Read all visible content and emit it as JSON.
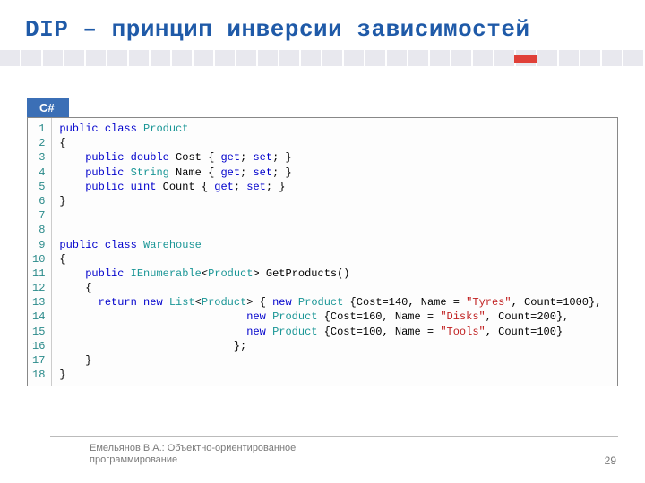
{
  "slide": {
    "title": "DIP – принцип инверсии зависимостей",
    "language_tab": "C#",
    "footer_author": "Емельянов В.А.: Объектно-ориентированное программирование",
    "page_number": "29"
  },
  "code": {
    "line_numbers": [
      "1",
      "2",
      "3",
      "4",
      "5",
      "6",
      "7",
      "8",
      "9",
      "10",
      "11",
      "12",
      "13",
      "14",
      "15",
      "16",
      "17",
      "18"
    ],
    "lines": [
      [
        {
          "t": "public",
          "c": "kw"
        },
        {
          "t": " ",
          "c": "plain"
        },
        {
          "t": "class",
          "c": "kw"
        },
        {
          "t": " ",
          "c": "plain"
        },
        {
          "t": "Product",
          "c": "type"
        }
      ],
      [
        {
          "t": "{",
          "c": "plain"
        }
      ],
      [
        {
          "t": "    ",
          "c": "plain"
        },
        {
          "t": "public",
          "c": "kw"
        },
        {
          "t": " ",
          "c": "plain"
        },
        {
          "t": "double",
          "c": "kw"
        },
        {
          "t": " Cost { ",
          "c": "plain"
        },
        {
          "t": "get",
          "c": "kw"
        },
        {
          "t": "; ",
          "c": "plain"
        },
        {
          "t": "set",
          "c": "kw"
        },
        {
          "t": "; }",
          "c": "plain"
        }
      ],
      [
        {
          "t": "    ",
          "c": "plain"
        },
        {
          "t": "public",
          "c": "kw"
        },
        {
          "t": " ",
          "c": "plain"
        },
        {
          "t": "String",
          "c": "type"
        },
        {
          "t": " Name { ",
          "c": "plain"
        },
        {
          "t": "get",
          "c": "kw"
        },
        {
          "t": "; ",
          "c": "plain"
        },
        {
          "t": "set",
          "c": "kw"
        },
        {
          "t": "; }",
          "c": "plain"
        }
      ],
      [
        {
          "t": "    ",
          "c": "plain"
        },
        {
          "t": "public",
          "c": "kw"
        },
        {
          "t": " ",
          "c": "plain"
        },
        {
          "t": "uint",
          "c": "kw"
        },
        {
          "t": " Count { ",
          "c": "plain"
        },
        {
          "t": "get",
          "c": "kw"
        },
        {
          "t": "; ",
          "c": "plain"
        },
        {
          "t": "set",
          "c": "kw"
        },
        {
          "t": "; }",
          "c": "plain"
        }
      ],
      [
        {
          "t": "}",
          "c": "plain"
        }
      ],
      [
        {
          "t": " ",
          "c": "plain"
        }
      ],
      [
        {
          "t": " ",
          "c": "plain"
        }
      ],
      [
        {
          "t": "public",
          "c": "kw"
        },
        {
          "t": " ",
          "c": "plain"
        },
        {
          "t": "class",
          "c": "kw"
        },
        {
          "t": " ",
          "c": "plain"
        },
        {
          "t": "Warehouse",
          "c": "type"
        }
      ],
      [
        {
          "t": "{",
          "c": "plain"
        }
      ],
      [
        {
          "t": "    ",
          "c": "plain"
        },
        {
          "t": "public",
          "c": "kw"
        },
        {
          "t": " ",
          "c": "plain"
        },
        {
          "t": "IEnumerable",
          "c": "type"
        },
        {
          "t": "<",
          "c": "plain"
        },
        {
          "t": "Product",
          "c": "type"
        },
        {
          "t": "> GetProducts()",
          "c": "plain"
        }
      ],
      [
        {
          "t": "    {",
          "c": "plain"
        }
      ],
      [
        {
          "t": "      ",
          "c": "plain"
        },
        {
          "t": "return",
          "c": "kw"
        },
        {
          "t": " ",
          "c": "plain"
        },
        {
          "t": "new",
          "c": "kw"
        },
        {
          "t": " ",
          "c": "plain"
        },
        {
          "t": "List",
          "c": "type"
        },
        {
          "t": "<",
          "c": "plain"
        },
        {
          "t": "Product",
          "c": "type"
        },
        {
          "t": "> { ",
          "c": "plain"
        },
        {
          "t": "new",
          "c": "kw"
        },
        {
          "t": " ",
          "c": "plain"
        },
        {
          "t": "Product",
          "c": "type"
        },
        {
          "t": " {Cost=140, Name = ",
          "c": "plain"
        },
        {
          "t": "\"Tyres\"",
          "c": "str"
        },
        {
          "t": ", Count=1000},",
          "c": "plain"
        }
      ],
      [
        {
          "t": "                             ",
          "c": "plain"
        },
        {
          "t": "new",
          "c": "kw"
        },
        {
          "t": " ",
          "c": "plain"
        },
        {
          "t": "Product",
          "c": "type"
        },
        {
          "t": " {Cost=160, Name = ",
          "c": "plain"
        },
        {
          "t": "\"Disks\"",
          "c": "str"
        },
        {
          "t": ", Count=200},",
          "c": "plain"
        }
      ],
      [
        {
          "t": "                             ",
          "c": "plain"
        },
        {
          "t": "new",
          "c": "kw"
        },
        {
          "t": " ",
          "c": "plain"
        },
        {
          "t": "Product",
          "c": "type"
        },
        {
          "t": " {Cost=100, Name = ",
          "c": "plain"
        },
        {
          "t": "\"Tools\"",
          "c": "str"
        },
        {
          "t": ", Count=100}",
          "c": "plain"
        }
      ],
      [
        {
          "t": "                           };",
          "c": "plain"
        }
      ],
      [
        {
          "t": "    }",
          "c": "plain"
        }
      ],
      [
        {
          "t": "}",
          "c": "plain"
        }
      ]
    ]
  }
}
